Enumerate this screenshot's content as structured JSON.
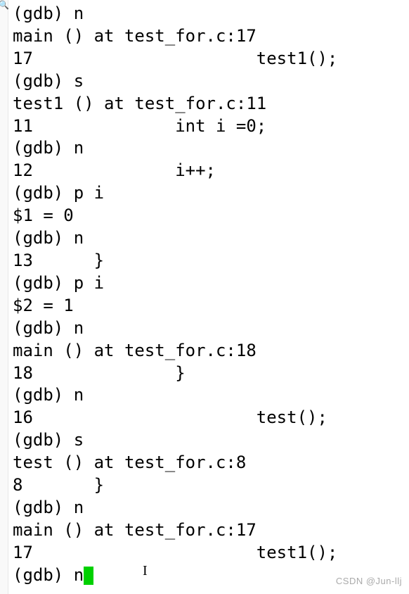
{
  "lines": [
    "(gdb) n",
    "main () at test_for.c:17",
    "17                      test1();",
    "(gdb) s",
    "test1 () at test_for.c:11",
    "11              int i =0;",
    "(gdb) n",
    "12              i++;",
    "(gdb) p i",
    "$1 = 0",
    "(gdb) n",
    "13      }",
    "(gdb) p i",
    "$2 = 1",
    "(gdb) n",
    "main () at test_for.c:18",
    "18              }",
    "(gdb) n",
    "16                      test();",
    "(gdb) s",
    "test () at test_for.c:8",
    "8       }",
    "(gdb) n",
    "main () at test_for.c:17",
    "17                      test1();"
  ],
  "prompt": "(gdb) n",
  "watermark": "CSDN @Jun-llj",
  "text_cursor_char": "I"
}
